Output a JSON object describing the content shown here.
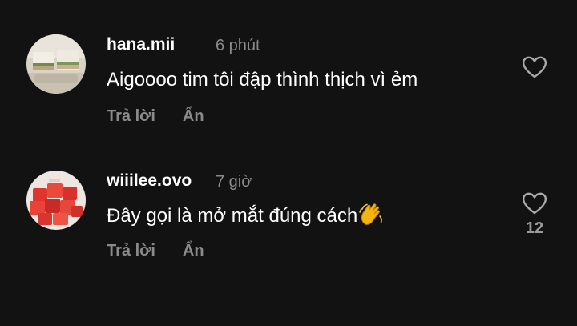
{
  "comments": [
    {
      "username": "hana.mii",
      "time": "6 phút",
      "text": "Aigoooo tim tôi đập thình thịch vì ẻm",
      "reply_label": "Trả lời",
      "hide_label": "Ẩn",
      "avatar_icon": "food-photo-avatar",
      "like_icon": "heart-outline-icon",
      "like_count": ""
    },
    {
      "username": "wiiilee.ovo",
      "time": "7 giờ",
      "text": "Đây gọi là mở mắt đúng cách",
      "emoji": "clapping-hands-emoji",
      "reply_label": "Trả lời",
      "hide_label": "Ẩn",
      "avatar_icon": "watermelon-cubes-avatar",
      "like_icon": "heart-outline-icon",
      "like_count": "12"
    }
  ],
  "colors": {
    "background": "#121212",
    "text_primary": "#ffffff",
    "text_secondary": "#8a8a8a"
  }
}
